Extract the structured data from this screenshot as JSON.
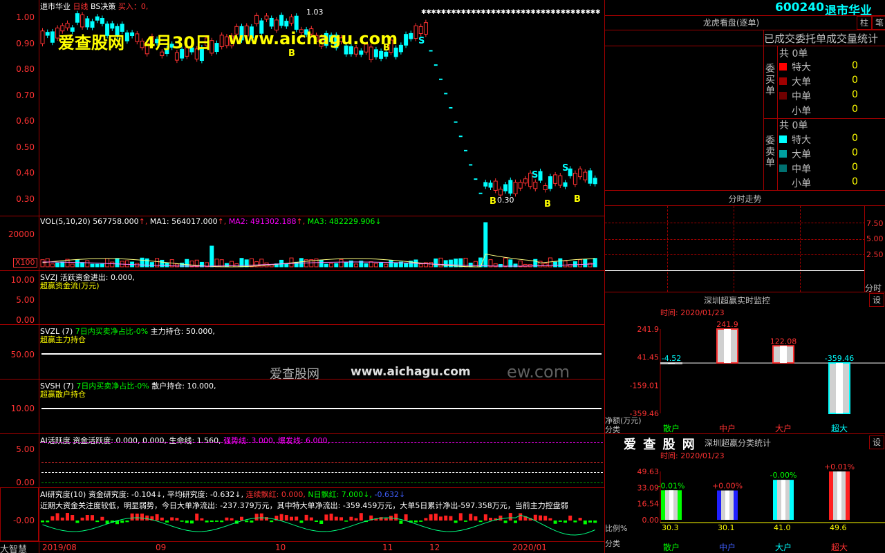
{
  "header": {
    "stock_name": "退市华业",
    "period": "日线",
    "indicator": "BS决策",
    "buy_text": "买入：0,"
  },
  "watermark": {
    "site": "爱查股网",
    "date": "4月30日",
    "url": "www.aichagu.com",
    "center_site": "爱查股网",
    "center_url": "www.aichagu.com",
    "center_suffix": "ew.com"
  },
  "main_chart": {
    "y_ticks": [
      "1.00",
      "0.90",
      "0.80",
      "0.70",
      "0.60",
      "0.50",
      "0.40",
      "0.30"
    ],
    "high_label": "1.03",
    "low_label": "0.30",
    "markers": [
      "B",
      "B",
      "S",
      "S",
      "B",
      "S",
      "B",
      "B"
    ]
  },
  "vol_panel": {
    "title": "VOL(5,10,20)",
    "vol": "567758.000",
    "ma1": "MA1: 564017.000",
    "ma2": "MA2: 491302.188",
    "ma3": "MA3: 482229.906",
    "y_tick": "20000",
    "unit": "X100"
  },
  "svzj_panel": {
    "title": "SVZJ",
    "line1": "活跃资金进出: 0.000,",
    "line2": "超赢资金流(万元)",
    "y_ticks": [
      "10.00",
      "5.00",
      "0.00"
    ]
  },
  "svzl_panel": {
    "title": "SVZL (7)",
    "ratio": "7日内买卖净占比-0%",
    "hold": "主力持仓: 50.000,",
    "line2": "超赢主力持仓",
    "y_tick": "50.00"
  },
  "svsh_panel": {
    "title": "SVSH (7)",
    "ratio": "7日内买卖净占比-0%",
    "hold": "散户持仓: 10.000,",
    "line2": "超赢散户持仓",
    "y_tick": "10.00"
  },
  "ai_active": {
    "title": "AI活跃度",
    "text": "资金活跃度: 0.000, 0.000, 生命线: 1.560,",
    "strong": "强势线: 3.000,",
    "burst": "爆发线: 6.000,",
    "y_ticks": [
      "5.00",
      "0.00"
    ]
  },
  "ai_research": {
    "title": "AI研究度(10)",
    "val1": "资金研究度: -0.104↓,",
    "val2": "平均研究度: -0.632↓,",
    "val3": "连续飘红: 0.000,",
    "val4": "N日飘红: 7.000↓,",
    "val5": "-0.632↓",
    "summary": "近期大资金关注度较低，明显弱势，今日大单净流出: -237.379万元，其中特大单净流出: -359.459万元，大单5日累计净出-597.358万元，当前主力控盘弱",
    "y_tick": "-0.00"
  },
  "x_axis": {
    "dates": [
      "2019/08",
      "09",
      "10",
      "11",
      "12",
      "2020/01"
    ]
  },
  "bottom_left_label": "大智慧",
  "right_panel": {
    "code": "600240",
    "name": "退市华业",
    "btn_zhu": "柱",
    "btn_bi": "笔",
    "lhb_title": "龙虎看盘(逐单)",
    "lhb_subtitle": "已成交委托单成交量统计",
    "buy_side_label": "委买单",
    "sell_side_label": "委卖单",
    "buy_total": "共 0单",
    "sell_total": "共 0单",
    "buy_rows": [
      {
        "label": "特大",
        "value": "0",
        "color": "#ff0000"
      },
      {
        "label": "大单",
        "value": "0",
        "color": "#a00000"
      },
      {
        "label": "中单",
        "value": "0",
        "color": "#700000"
      },
      {
        "label": "小单",
        "value": "0",
        "color": ""
      }
    ],
    "sell_rows": [
      {
        "label": "特大",
        "value": "0",
        "color": "#00ffff"
      },
      {
        "label": "大单",
        "value": "0",
        "color": "#00a0a0"
      },
      {
        "label": "中单",
        "value": "0",
        "color": "#007070"
      },
      {
        "label": "小单",
        "value": "0",
        "color": ""
      }
    ],
    "intraday_title": "分时走势",
    "intraday_ticks": [
      "7.50",
      "5.00",
      "2.50"
    ],
    "intraday_unit": "分时",
    "monitor_title": "深圳超赢实时监控",
    "monitor_btn": "设",
    "monitor_time": "时间: 2020/01/23",
    "monitor_y_ticks": [
      "241.9",
      "41.45",
      "-159.01",
      "-359.46"
    ],
    "monitor_y_unit": "净额(万元)",
    "monitor_x_unit": "分类",
    "monitor_bars": [
      {
        "label": "散户",
        "value": "-4.52"
      },
      {
        "label": "中户",
        "value": "241.9"
      },
      {
        "label": "大户",
        "value": "122.08"
      },
      {
        "label": "超大",
        "value": "-359.46"
      }
    ],
    "class_logo": "爱 查 股 网",
    "class_title": "深圳超赢分类统计",
    "class_btn": "设",
    "class_time": "时间: 2020/01/23",
    "class_y_ticks": [
      "49.63",
      "33.09",
      "16.54",
      "0.00"
    ],
    "class_y_unit": "比例%",
    "class_x_unit": "分类",
    "class_bars": [
      {
        "label": "散户",
        "pct": "-0.01%",
        "value": "30.3",
        "color": "#00ff00"
      },
      {
        "label": "中户",
        "pct": "+0.00%",
        "value": "30.1",
        "color": "#2020ff"
      },
      {
        "label": "大户",
        "pct": "-0.00%",
        "value": "41.0",
        "color": "#00ffff"
      },
      {
        "label": "超大",
        "pct": "+0.01%",
        "value": "49.6",
        "color": "#ff2020"
      }
    ]
  },
  "chart_data": [
    {
      "type": "bar",
      "title": "深圳超赢实时监控",
      "categories": [
        "散户",
        "中户",
        "大户",
        "超大"
      ],
      "values": [
        -4.52,
        241.9,
        122.08,
        -359.46
      ],
      "ylabel": "净额(万元)",
      "xlabel": "分类",
      "ylim": [
        -359.46,
        241.9
      ]
    },
    {
      "type": "bar",
      "title": "深圳超赢分类统计",
      "categories": [
        "散户",
        "中户",
        "大户",
        "超大"
      ],
      "values": [
        30.3,
        30.1,
        41.0,
        49.6
      ],
      "ylabel": "比例%",
      "xlabel": "分类",
      "ylim": [
        0,
        49.63
      ]
    }
  ]
}
